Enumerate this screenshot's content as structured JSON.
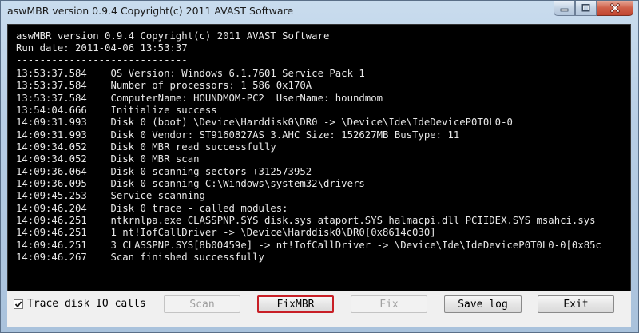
{
  "window": {
    "title": "aswMBR version 0.9.4 Copyright(c) 2011 AVAST Software"
  },
  "console": {
    "lines": [
      "aswMBR version 0.9.4 Copyright(c) 2011 AVAST Software",
      "Run date: 2011-04-06 13:53:37",
      "-----------------------------",
      "13:53:37.584    OS Version: Windows 6.1.7601 Service Pack 1",
      "13:53:37.584    Number of processors: 1 586 0x170A",
      "13:53:37.584    ComputerName: HOUNDMOM-PC2  UserName: houndmom",
      "13:54:04.666    Initialize success",
      "14:09:31.993    Disk 0 (boot) \\Device\\Harddisk0\\DR0 -> \\Device\\Ide\\IdeDeviceP0T0L0-0",
      "14:09:31.993    Disk 0 Vendor: ST9160827AS 3.AHC Size: 152627MB BusType: 11",
      "14:09:34.052    Disk 0 MBR read successfully",
      "14:09:34.052    Disk 0 MBR scan",
      "14:09:36.064    Disk 0 scanning sectors +312573952",
      "14:09:36.095    Disk 0 scanning C:\\Windows\\system32\\drivers",
      "14:09:45.253    Service scanning",
      "14:09:46.204    Disk 0 trace - called modules:",
      "14:09:46.251    ntkrnlpa.exe CLASSPNP.SYS disk.sys ataport.SYS halmacpi.dll PCIIDEX.SYS msahci.sys",
      "14:09:46.251    1 nt!IofCallDriver -> \\Device\\Harddisk0\\DR0[0x8614c030]",
      "14:09:46.251    3 CLASSPNP.SYS[8b00459e] -> nt!IofCallDriver -> \\Device\\Ide\\IdeDeviceP0T0L0-0[0x85c",
      "14:09:46.267    Scan finished successfully"
    ]
  },
  "controls": {
    "trace_label": "Trace disk IO calls",
    "trace_checked": true,
    "scan": "Scan",
    "fixmbr": "FixMBR",
    "fix": "Fix",
    "save_log": "Save log",
    "exit": "Exit"
  }
}
